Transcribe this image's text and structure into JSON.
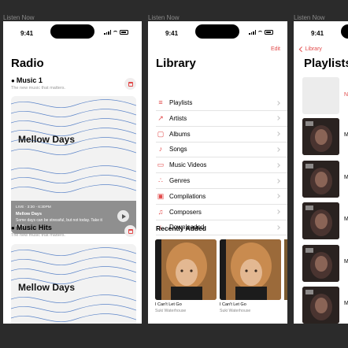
{
  "frames": [
    {
      "label": "Listen Now"
    },
    {
      "label": "Listen Now"
    },
    {
      "label": "Listen Now"
    }
  ],
  "status": {
    "time": "9:41"
  },
  "radio": {
    "title": "Radio",
    "sections": [
      {
        "name": "Music 1",
        "subtitle": "The new music that matters.",
        "card_title": "Mellow Days",
        "live": "LIVE · 3:30 - 6:30PM",
        "show": "Mellow Days",
        "description": "Some days can be stressful, but not today. Take it easy."
      },
      {
        "name": "Music Hits",
        "subtitle": "The new music that matters.",
        "card_title": "Mellow Days"
      }
    ]
  },
  "library": {
    "title": "Library",
    "edit": "Edit",
    "items": [
      {
        "label": "Playlists",
        "icon": "playlist-icon",
        "glyph": "≡"
      },
      {
        "label": "Artists",
        "icon": "microphone-icon",
        "glyph": "↗"
      },
      {
        "label": "Albums",
        "icon": "album-icon",
        "glyph": "▢"
      },
      {
        "label": "Songs",
        "icon": "note-icon",
        "glyph": "♪"
      },
      {
        "label": "Music Videos",
        "icon": "tv-icon",
        "glyph": "▭"
      },
      {
        "label": "Genres",
        "icon": "genres-icon",
        "glyph": "∴"
      },
      {
        "label": "Compilations",
        "icon": "compilations-icon",
        "glyph": "▣"
      },
      {
        "label": "Composers",
        "icon": "notes-icon",
        "glyph": "♫"
      },
      {
        "label": "Downloaded",
        "icon": "download-icon",
        "glyph": "↓"
      }
    ],
    "recent_title": "Recently Added",
    "albums": [
      {
        "name": "I Can't Let Go",
        "artist": "Suki Waterhouse"
      },
      {
        "name": "I Can't Let Go",
        "artist": "Suki Waterhouse"
      }
    ]
  },
  "playlists": {
    "back": "Library",
    "title": "Playlists",
    "items": [
      {
        "initial": "M"
      },
      {
        "initial": "M"
      },
      {
        "initial": "M"
      },
      {
        "initial": "M"
      },
      {
        "initial": "M"
      }
    ]
  },
  "colors": {
    "accent": "#e24a4a",
    "background": "#2b2b2b",
    "wave": "#5b84c8"
  }
}
